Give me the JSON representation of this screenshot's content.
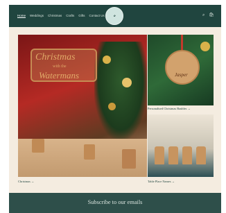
{
  "header": {
    "nav": [
      "Home",
      "Weddings",
      "Christmas",
      "Crafts",
      "Gifts",
      "Contact Us"
    ],
    "active_nav": "Home",
    "logo_icon": "brand-logo-badge",
    "icons": [
      "search-icon",
      "cart-icon"
    ]
  },
  "collections": [
    {
      "caption": "Christmas →"
    },
    {
      "caption": "Personalised Christmas Baubles →"
    },
    {
      "caption": "Table Place Names →"
    }
  ],
  "main_image": {
    "sign_line1": "Christmas",
    "sign_line2": "with the",
    "sign_line3": "Watermans"
  },
  "bauble_image": {
    "name": "Jasper"
  },
  "footer": {
    "subscribe": "Subscribe to our emails"
  },
  "colors": {
    "header_bg": "#20453f",
    "page_bg": "#f4ece0",
    "footer_bg": "#2e4f4a"
  }
}
